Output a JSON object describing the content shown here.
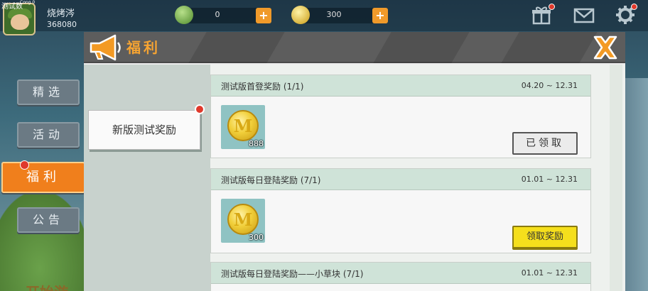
{
  "debug": {
    "label": "测试数",
    "tiny": "Cong 0"
  },
  "player": {
    "name": "烧烤涔",
    "id": "368080"
  },
  "currency": [
    {
      "name": "green-gem",
      "value": "0",
      "color": "#6aa84f"
    },
    {
      "name": "gold-coin",
      "value": "300",
      "color": "#e0b52a"
    }
  ],
  "icons": {
    "gift": "gift-icon",
    "mail": "mail-icon",
    "settings": "gear-icon"
  },
  "side_tabs": [
    {
      "label": "精选"
    },
    {
      "label": "活动"
    },
    {
      "label": "福利",
      "active": true
    },
    {
      "label": "公告"
    }
  ],
  "panel": {
    "title": "福利",
    "close": "✕"
  },
  "category": {
    "label": "新版测试奖励"
  },
  "rewards": [
    {
      "title": "测试版首登奖励 (1/1)",
      "date": "04.20 ~ 12.31",
      "item": "M",
      "qty": "888",
      "button": "已领取",
      "claimed": true
    },
    {
      "title": "测试版每日登陆奖励 (7/1)",
      "date": "01.01 ~ 12.31",
      "item": "M",
      "qty": "300",
      "button": "领取奖励",
      "claimed": false
    },
    {
      "title": "测试版每日登陆奖励——小草块 (7/1)",
      "date": "01.01 ~ 12.31"
    }
  ],
  "bottom": {
    "text": "开始游"
  },
  "colors": {
    "accent": "#f07f1c",
    "header": "#5d5d5d",
    "claim": "#f5df1c"
  }
}
